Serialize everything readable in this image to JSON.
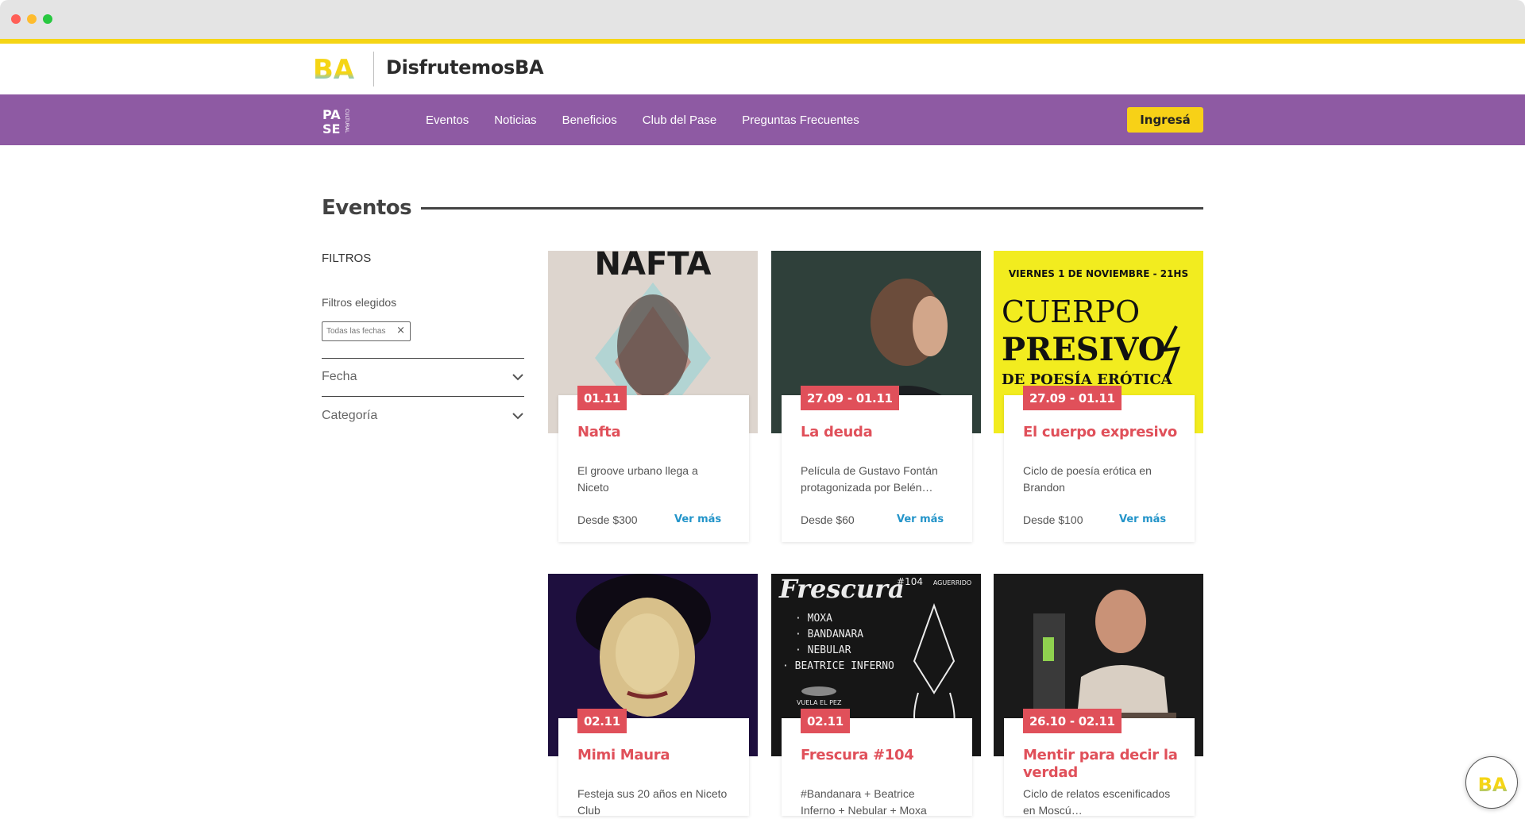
{
  "brand": {
    "title": "DisfrutemosBA",
    "logo_text": "BA",
    "pase_logo_text": [
      "PA",
      "SE",
      "CULTURAL"
    ]
  },
  "nav": {
    "links": [
      "Eventos",
      "Noticias",
      "Beneficios",
      "Club del Pase",
      "Preguntas Frecuentes"
    ],
    "login_label": "Ingresá"
  },
  "section": {
    "title": "Eventos"
  },
  "filters": {
    "label": "FILTROS",
    "chosen_label": "Filtros elegidos",
    "chip": "Todas las fechas",
    "chip_remove": "×",
    "accordions": [
      "Fecha",
      "Categoría"
    ]
  },
  "events": [
    {
      "date": "01.11",
      "title": "Nafta",
      "desc": "El groove urbano llega a Niceto",
      "price": "Desde $300",
      "more": "Ver más",
      "img_text": "NAFTA"
    },
    {
      "date": "27.09 - 01.11",
      "title": "La deuda",
      "desc": "Película de Gustavo Fontán protagonizada por Belén…",
      "price": "Desde $60",
      "more": "Ver más"
    },
    {
      "date": "27.09 - 01.11",
      "title": "El cuerpo expresivo",
      "desc": "Ciclo de poesía erótica en Brandon",
      "price": "Desde $100",
      "more": "Ver más",
      "img_text": [
        "VIERNES 1 DE NOVIEMBRE - 21HS",
        "CUERPO",
        "PRESIVO",
        "DE POESÍA ERÓTICA"
      ]
    },
    {
      "date": "02.11",
      "title": "Mimi Maura",
      "desc": "Festeja sus 20 años en Niceto Club"
    },
    {
      "date": "02.11",
      "title": "Frescura #104",
      "desc": "#Bandanara + Beatrice Inferno + Nebular + Moxa",
      "img_text": [
        "Frescura",
        "#104",
        "· MOXA",
        "· BANDANARA",
        "· NEBULAR",
        "· BEATRICE INFERNO",
        "VUELA EL PEZ",
        "AGUERRIDO"
      ]
    },
    {
      "date": "26.10 - 02.11",
      "title": "Mentir para decir la verdad",
      "desc": "Ciclo de relatos escenificados en Moscú…"
    }
  ],
  "colors": {
    "accent": "#e0505a",
    "nav": "#8e5aa3",
    "yellow": "#f7d117",
    "link": "#2394c9"
  }
}
